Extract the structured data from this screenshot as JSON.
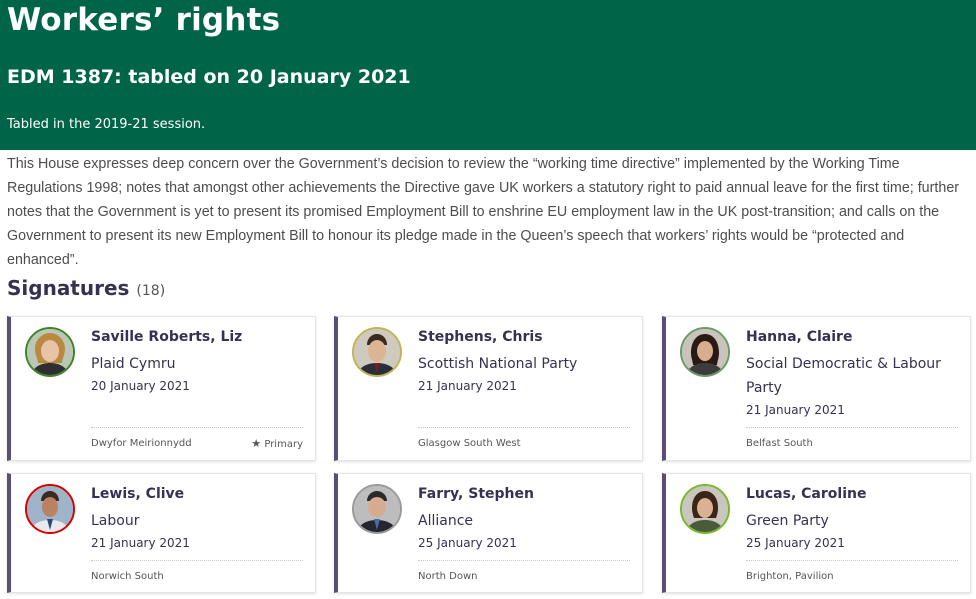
{
  "header": {
    "title": "Workers’ rights",
    "subtitle": "EDM 1387: tabled on 20 January 2021",
    "session": "Tabled in the 2019-21 session."
  },
  "motion_text": "This House expresses deep concern over the Government’s decision to review the “working time directive” implemented by the Working Time Regulations 1998; notes that amongst other achievements the Directive gave UK workers a statutory right to paid annual leave for the first time; further notes that the Government is yet to present its promised Employment Bill to enshrine EU employment law in the UK post-transition; and calls on the Government to present its new Employment Bill to honour its pledge made in the Queen’s speech that workers’ rights would be “protected and enhanced”.",
  "signatures": {
    "heading": "Signatures",
    "count": "(18)",
    "cards": [
      {
        "name": "Saville Roberts, Liz",
        "party": "Plaid Cymru",
        "date": "20 January 2021",
        "constituency": "Dwyfor Meirionnydd",
        "primary": "Primary",
        "party_color": "#3f8428"
      },
      {
        "name": "Stephens, Chris",
        "party": "Scottish National Party",
        "date": "21 January 2021",
        "constituency": "Glasgow South West",
        "primary": "",
        "party_color": "#c4b454"
      },
      {
        "name": "Hanna, Claire",
        "party": "Social Democratic & Labour Party",
        "date": "21 January 2021",
        "constituency": "Belfast South",
        "primary": "",
        "party_color": "#6c9b67"
      },
      {
        "name": "Lewis, Clive",
        "party": "Labour",
        "date": "21 January 2021",
        "constituency": "Norwich South",
        "primary": "",
        "party_color": "#d50000"
      },
      {
        "name": "Farry, Stephen",
        "party": "Alliance",
        "date": "25 January 2021",
        "constituency": "North Down",
        "primary": "",
        "party_color": "#9a9a9a"
      },
      {
        "name": "Lucas, Caroline",
        "party": "Green Party",
        "date": "25 January 2021",
        "constituency": "Brighton, Pavilion",
        "primary": "",
        "party_color": "#78b82a"
      }
    ]
  },
  "colors": {
    "header_bg": "#006548",
    "card_accent": "#5b4e76",
    "text": "#373151"
  },
  "icons": {
    "primary": "star-icon"
  }
}
